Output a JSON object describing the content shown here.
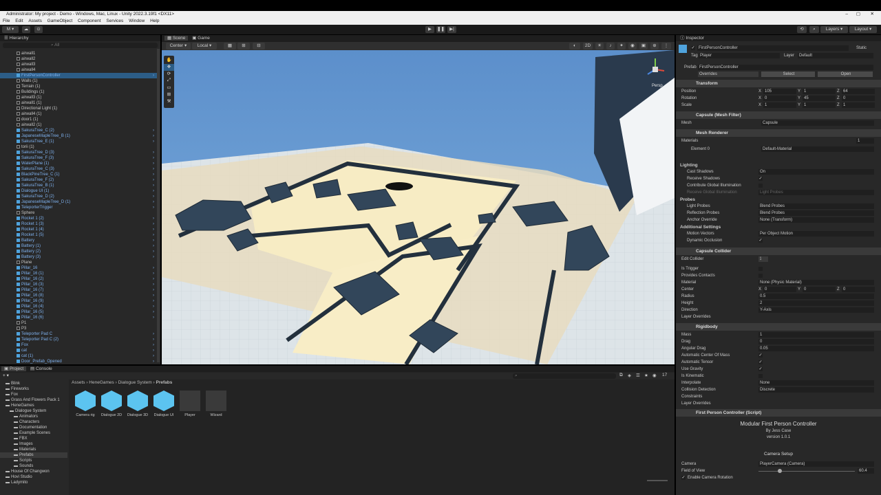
{
  "window": {
    "title": "Administrator: My project - Demo - Windows, Mac, Linux - Unity 2022.3.19f1 <DX11>"
  },
  "menu": [
    "File",
    "Edit",
    "Assets",
    "GameObject",
    "Component",
    "Services",
    "Window",
    "Help"
  ],
  "toolbar": {
    "account": "M",
    "layers": "Layers",
    "layout": "Layout"
  },
  "hierarchy": {
    "title": "Hierarchy",
    "search_placeholder": "All",
    "items": [
      {
        "label": "airwall1",
        "blue": false
      },
      {
        "label": "airwall2",
        "blue": false
      },
      {
        "label": "airwall3",
        "blue": false
      },
      {
        "label": "airwall4",
        "blue": false
      },
      {
        "label": "FirstPersonController",
        "blue": true
      },
      {
        "label": "Walls (1)",
        "blue": false
      },
      {
        "label": "Terrain (1)",
        "blue": false
      },
      {
        "label": "Buildings (1)",
        "blue": false
      },
      {
        "label": "airwall3 (1)",
        "blue": false
      },
      {
        "label": "airwall1 (1)",
        "blue": false
      },
      {
        "label": "Directional Light (1)",
        "blue": false
      },
      {
        "label": "airwall4 (1)",
        "blue": false
      },
      {
        "label": "door1 (1)",
        "blue": false
      },
      {
        "label": "airwall2 (1)",
        "blue": false
      },
      {
        "label": "SakuraTree_C (2)",
        "blue": true
      },
      {
        "label": "JapaneseMapleTree_B (1)",
        "blue": true
      },
      {
        "label": "SakuraTree_E (1)",
        "blue": true
      },
      {
        "label": "torii (1)",
        "blue": false
      },
      {
        "label": "SakuraTree_D (3)",
        "blue": true
      },
      {
        "label": "SakuraTree_F (3)",
        "blue": true
      },
      {
        "label": "WaterPlane (1)",
        "blue": true
      },
      {
        "label": "SakuraTree_C (3)",
        "blue": true
      },
      {
        "label": "BlackPineTree_C (1)",
        "blue": true
      },
      {
        "label": "SakuraTree_F (2)",
        "blue": true
      },
      {
        "label": "SakuraTree_B (1)",
        "blue": true
      },
      {
        "label": "Dialogue UI (1)",
        "blue": true
      },
      {
        "label": "SakuraTree_D (2)",
        "blue": true
      },
      {
        "label": "JapaneseMapleTree_D (1)",
        "blue": true
      },
      {
        "label": "TeleporterTrigger",
        "blue": true
      },
      {
        "label": "Sphere",
        "blue": false
      },
      {
        "label": "Rocket 1 (2)",
        "blue": true
      },
      {
        "label": "Rocket 1 (3)",
        "blue": true
      },
      {
        "label": "Rocket 1 (4)",
        "blue": true
      },
      {
        "label": "Rocket 1 (5)",
        "blue": true
      },
      {
        "label": "Battery",
        "blue": true
      },
      {
        "label": "Battery (1)",
        "blue": true
      },
      {
        "label": "Battery (2)",
        "blue": true
      },
      {
        "label": "Battery (3)",
        "blue": true
      },
      {
        "label": "Plane",
        "blue": false
      },
      {
        "label": "Pillar_16",
        "blue": true
      },
      {
        "label": "Pillar_16 (1)",
        "blue": true
      },
      {
        "label": "Pillar_16 (2)",
        "blue": true
      },
      {
        "label": "Pillar_16 (3)",
        "blue": true
      },
      {
        "label": "Pillar_16 (7)",
        "blue": true
      },
      {
        "label": "Pillar_16 (8)",
        "blue": true
      },
      {
        "label": "Pillar_16 (9)",
        "blue": true
      },
      {
        "label": "Pillar_16 (4)",
        "blue": true
      },
      {
        "label": "Pillar_16 (5)",
        "blue": true
      },
      {
        "label": "Pillar_16 (6)",
        "blue": true
      },
      {
        "label": "P1",
        "blue": false
      },
      {
        "label": "P3",
        "blue": false
      },
      {
        "label": "Teleporter Pad C",
        "blue": true
      },
      {
        "label": "Teleporter Pad C (2)",
        "blue": true
      },
      {
        "label": "Fox",
        "blue": true
      },
      {
        "label": "cat",
        "blue": true
      },
      {
        "label": "cat (1)",
        "blue": true
      },
      {
        "label": "Door_Prefab_Opened",
        "blue": true
      }
    ]
  },
  "scene": {
    "tabs": [
      "Scene",
      "Game"
    ],
    "pivot": "Center",
    "space": "Local",
    "mode2d": "2D",
    "gizmo_label": "Persp"
  },
  "project": {
    "tabs": [
      "Project",
      "Console"
    ],
    "breadcrumb": [
      "Assets",
      "HeneGames",
      "Dialogue System",
      "Prefabs"
    ],
    "hidden_count": "17",
    "tree": [
      {
        "label": "Blink",
        "indent": 1
      },
      {
        "label": "Fireworks",
        "indent": 1
      },
      {
        "label": "Fox",
        "indent": 1
      },
      {
        "label": "Grass And Flowers Pack 1",
        "indent": 1
      },
      {
        "label": "HeneGames",
        "indent": 1
      },
      {
        "label": "Dialogue System",
        "indent": 2
      },
      {
        "label": "Animators",
        "indent": 3
      },
      {
        "label": "Characters",
        "indent": 3
      },
      {
        "label": "Documentation",
        "indent": 3
      },
      {
        "label": "Example Scenes",
        "indent": 3
      },
      {
        "label": "FBX",
        "indent": 3
      },
      {
        "label": "Images",
        "indent": 3
      },
      {
        "label": "Materials",
        "indent": 3
      },
      {
        "label": "Prefabs",
        "indent": 3
      },
      {
        "label": "Scripts",
        "indent": 3
      },
      {
        "label": "Sounds",
        "indent": 3
      },
      {
        "label": "House Of Changwon",
        "indent": 1
      },
      {
        "label": "Hovi Studio",
        "indent": 1
      },
      {
        "label": "Ladymito",
        "indent": 1
      }
    ],
    "assets": [
      "Camera rig",
      "Dialogue 2D",
      "Dialogue 3D",
      "Dialogue UI",
      "Player",
      "Wizard"
    ]
  },
  "inspector": {
    "title": "Inspector",
    "object_name": "FirstPersonController",
    "static": "Static",
    "tag_label": "Tag",
    "tag": "Player",
    "layer_label": "Layer",
    "layer": "Default",
    "prefab_label": "Prefab",
    "prefab": "FirstPersonController",
    "overrides": "Overrides",
    "select": "Select",
    "open": "Open",
    "transform": {
      "title": "Transform",
      "position_label": "Position",
      "rotation_label": "Rotation",
      "scale_label": "Scale",
      "position": [
        "105",
        "1",
        "64"
      ],
      "rotation": [
        "0",
        "45",
        "0"
      ],
      "scale": [
        "1",
        "1",
        "1"
      ]
    },
    "mesh_filter": {
      "title": "Capsule (Mesh Filter)",
      "mesh_label": "Mesh",
      "mesh": "Capsule"
    },
    "mesh_renderer": {
      "title": "Mesh Renderer",
      "materials_label": "Materials",
      "materials_count": "1",
      "element_label": "Element 0",
      "element": "Default-Material",
      "lighting": "Lighting",
      "cast_label": "Cast Shadows",
      "cast": "On",
      "receive_label": "Receive Shadows",
      "contrib_label": "Contribute Global Illumination",
      "receive_gi_label": "Receive Global Illumination",
      "receive_gi": "Light Probes",
      "probes": "Probes",
      "light_probes_label": "Light Probes",
      "light_probes": "Blend Probes",
      "refl_label": "Reflection Probes",
      "refl": "Blend Probes",
      "anchor_label": "Anchor Override",
      "anchor": "None (Transform)",
      "additional": "Additional Settings",
      "motion_label": "Motion Vectors",
      "motion": "Per Object Motion",
      "dyn_label": "Dynamic Occlusion"
    },
    "capsule_collider": {
      "title": "Capsule Collider",
      "edit_label": "Edit Collider",
      "trigger_label": "Is Trigger",
      "contacts_label": "Provides Contacts",
      "material_label": "Material",
      "material": "None (Physic Material)",
      "center_label": "Center",
      "center": [
        "0",
        "0",
        "0"
      ],
      "radius_label": "Radius",
      "radius": "0.5",
      "height_label": "Height",
      "height": "2",
      "direction_label": "Direction",
      "direction": "Y-Axis",
      "layer_overrides": "Layer Overrides"
    },
    "rigidbody": {
      "title": "Rigidbody",
      "mass_label": "Mass",
      "mass": "1",
      "drag_label": "Drag",
      "drag": "0",
      "ang_label": "Angular Drag",
      "ang": "0.05",
      "acm_label": "Automatic Center Of Mass",
      "at_label": "Automatic Tensor",
      "grav_label": "Use Gravity",
      "kin_label": "Is Kinematic",
      "interp_label": "Interpolate",
      "interp": "None",
      "coll_label": "Collision Detection",
      "coll": "Discrete",
      "constraints": "Constraints",
      "layer_overrides": "Layer Overrides"
    },
    "script": {
      "title": "First Person Controller (Script)",
      "header": "Modular First Person Controller",
      "author": "By Jess Case",
      "version": "version 1.0.1",
      "camera_setup": "Camera Setup",
      "camera_label": "Camera",
      "camera": "PlayerCamera (Camera)",
      "fov_label": "Field of View",
      "fov": "60.4",
      "rotation_label": "Enable Camera Rotation"
    }
  },
  "colors": {
    "accent": "#4fa3dd",
    "selected": "#2c5d87",
    "panel": "#282828"
  }
}
